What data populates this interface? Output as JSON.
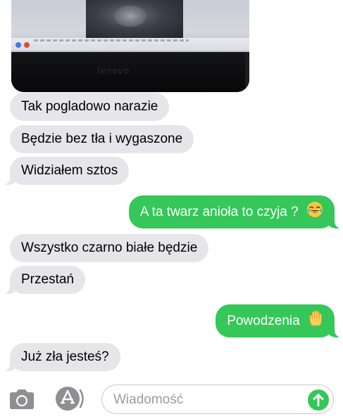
{
  "photo": {
    "brand_text": "lenovo"
  },
  "messages": [
    {
      "id": "m1",
      "direction": "incoming",
      "text": "Tak pogladowo narazie"
    },
    {
      "id": "m2",
      "direction": "incoming",
      "text": "Będzie bez tła i wygaszone"
    },
    {
      "id": "m3",
      "direction": "incoming",
      "text": "Widziałem sztos"
    },
    {
      "id": "m4",
      "direction": "outgoing",
      "text": "A ta twarz anioła to czyja ?",
      "emoji": "face-with-tears-of-joy-icon"
    },
    {
      "id": "m5",
      "direction": "incoming",
      "text": "Wszystko czarno białe będzie"
    },
    {
      "id": "m6",
      "direction": "incoming",
      "text": "Przestań"
    },
    {
      "id": "m7",
      "direction": "outgoing",
      "text": "Powodzenia",
      "emoji": "raised-hand-icon"
    },
    {
      "id": "m8",
      "direction": "incoming",
      "text": "Już zła jesteś?"
    }
  ],
  "input_bar": {
    "placeholder": "Wiadomość",
    "value": "",
    "icons": [
      "camera-icon",
      "app-store-icon",
      "send-arrow-icon"
    ]
  },
  "colors": {
    "incoming_bubble": "#e5e5ea",
    "outgoing_bubble": "#35c759",
    "placeholder": "#9b9ba1"
  }
}
